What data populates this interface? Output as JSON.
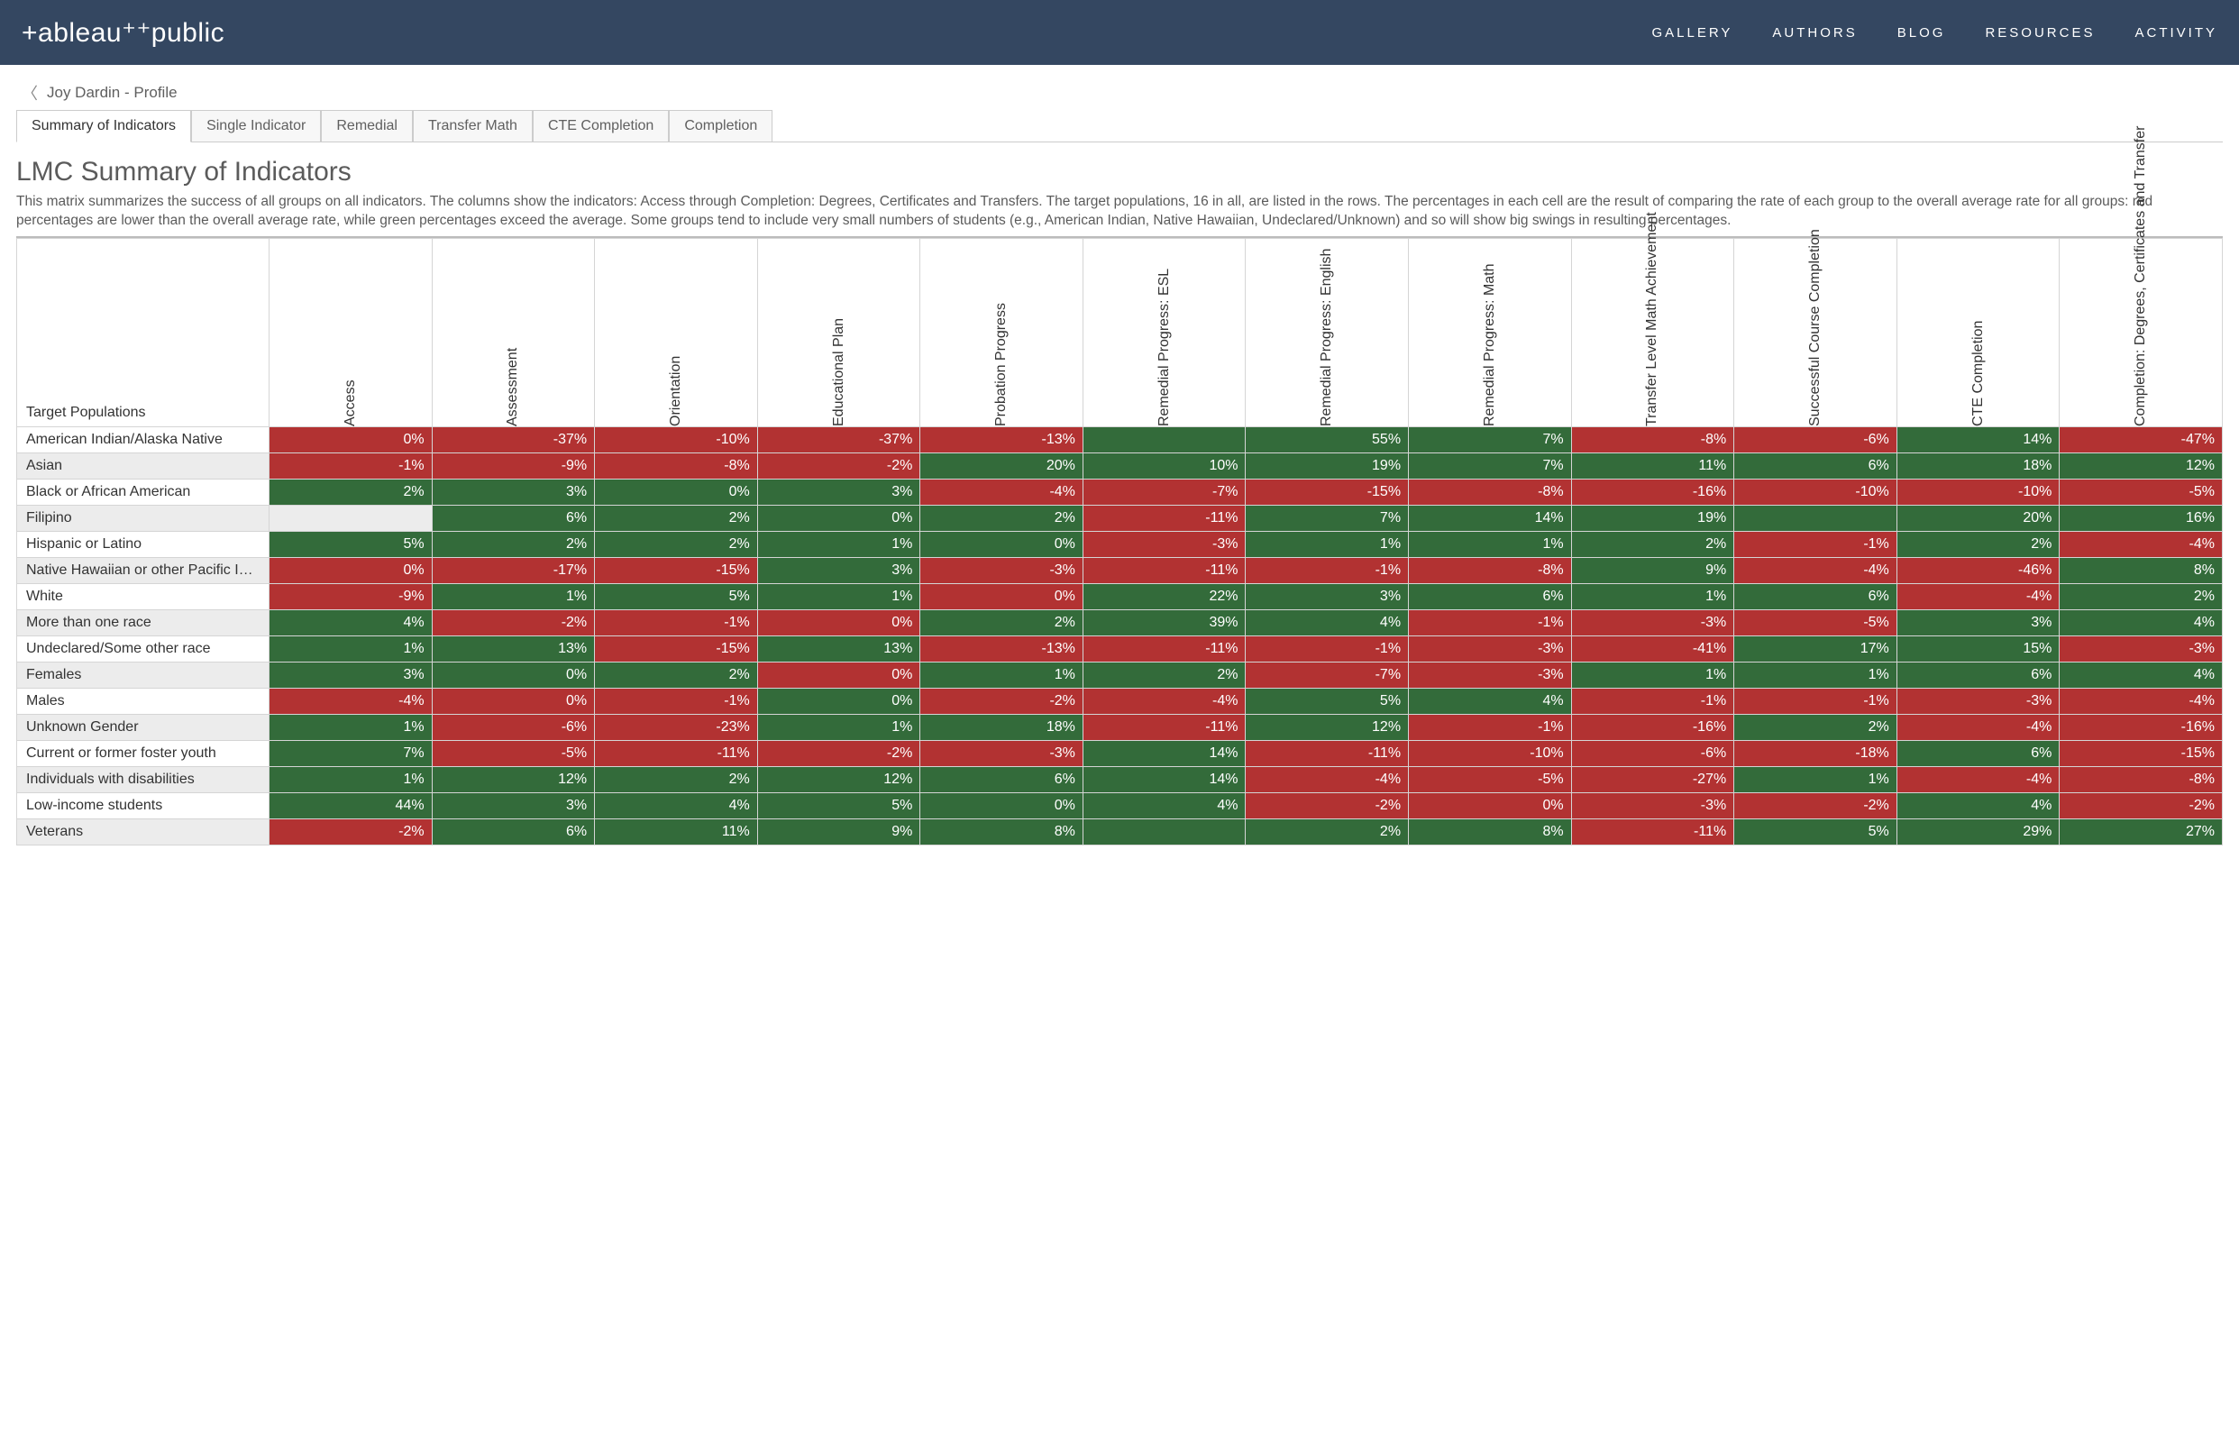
{
  "nav": {
    "brand": "+ableau⁺⁺public",
    "links": [
      "GALLERY",
      "AUTHORS",
      "BLOG",
      "RESOURCES",
      "ACTIVITY"
    ]
  },
  "breadcrumb": {
    "back_label": "Joy Dardin - Profile"
  },
  "tabs": [
    {
      "label": "Summary of Indicators",
      "active": true
    },
    {
      "label": "Single Indicator",
      "active": false
    },
    {
      "label": "Remedial",
      "active": false
    },
    {
      "label": "Transfer Math",
      "active": false
    },
    {
      "label": "CTE Completion",
      "active": false
    },
    {
      "label": "Completion",
      "active": false
    }
  ],
  "page": {
    "title": "LMC Summary of Indicators",
    "subtitle": "This matrix summarizes the success of all groups on all indicators. The columns show the indicators: Access through Completion: Degrees, Certificates and Transfers. The target populations, 16 in all, are listed in the rows. The percentages in each cell are the result of comparing the rate of each group to the overall average rate for all groups: red percentages are lower than the overall average rate, while green percentages exceed the average.  Some groups tend to include very small numbers of students (e.g., American Indian, Native Hawaiian, Undeclared/Unknown) and so will show big swings in resulting percentages.",
    "row_title": "Target Populations"
  },
  "colors": {
    "positive": "#336b3a",
    "negative": "#b23232",
    "nav_bg": "#344761"
  },
  "chart_data": {
    "type": "heatmap",
    "title": "LMC Summary of Indicators",
    "xlabel": "",
    "ylabel": "Target Populations",
    "columns": [
      "Access",
      "Assessment",
      "Orientation",
      "Educational Plan",
      "Probation Progress",
      "Remedial Progress: ESL",
      "Remedial Progress: English",
      "Remedial Progress: Math",
      "Transfer Level Math Achievement",
      "Successful Course Completion",
      "CTE Completion",
      "Completion: Degrees, Certificates and Transfer"
    ],
    "rows": [
      "American Indian/Alaska Native",
      "Asian",
      "Black or African American",
      "Filipino",
      "Hispanic or Latino",
      "Native Hawaiian or other Pacific Isla..",
      "White",
      "More than one race",
      "Undeclared/Some other race",
      "Females",
      "Males",
      "Unknown Gender",
      "Current or former foster youth",
      "Individuals with disabilities",
      "Low-income students",
      "Veterans"
    ],
    "values": [
      [
        0,
        -37,
        -10,
        -37,
        -13,
        null,
        55,
        7,
        -8,
        -6,
        14,
        -47
      ],
      [
        -1,
        -9,
        -8,
        -2,
        20,
        10,
        19,
        7,
        11,
        6,
        18,
        12
      ],
      [
        2,
        3,
        0,
        3,
        -4,
        -7,
        -15,
        -8,
        -16,
        -10,
        -10,
        -5
      ],
      [
        null,
        6,
        2,
        0,
        2,
        -11,
        7,
        14,
        19,
        null,
        20,
        16
      ],
      [
        5,
        2,
        2,
        1,
        0,
        -3,
        1,
        1,
        2,
        -1,
        2,
        -4
      ],
      [
        0,
        -17,
        -15,
        3,
        -3,
        -11,
        -1,
        -8,
        9,
        -4,
        -46,
        8
      ],
      [
        -9,
        1,
        5,
        1,
        0,
        22,
        3,
        6,
        1,
        6,
        -4,
        2
      ],
      [
        4,
        -2,
        -1,
        0,
        2,
        39,
        4,
        -1,
        -3,
        -5,
        3,
        4
      ],
      [
        1,
        13,
        -15,
        13,
        -13,
        -11,
        -1,
        -3,
        -41,
        17,
        15,
        -3
      ],
      [
        3,
        0,
        2,
        0,
        1,
        2,
        -7,
        -3,
        1,
        1,
        6,
        4
      ],
      [
        -4,
        0,
        -1,
        0,
        -2,
        -4,
        5,
        4,
        -1,
        -1,
        -3,
        -4
      ],
      [
        1,
        -6,
        -23,
        1,
        18,
        -11,
        12,
        -1,
        -16,
        2,
        -4,
        -16
      ],
      [
        7,
        -5,
        -11,
        -2,
        -3,
        14,
        -11,
        -10,
        -6,
        -18,
        6,
        -15
      ],
      [
        1,
        12,
        2,
        12,
        6,
        14,
        -4,
        -5,
        -27,
        1,
        -4,
        -8
      ],
      [
        44,
        3,
        4,
        5,
        0,
        4,
        -2,
        0,
        -3,
        -2,
        4,
        -2
      ],
      [
        -2,
        6,
        11,
        9,
        8,
        null,
        2,
        8,
        -11,
        5,
        29,
        27
      ]
    ],
    "signs": [
      [
        "neg",
        "neg",
        "neg",
        "neg",
        "neg",
        "pos",
        "pos",
        "pos",
        "neg",
        "neg",
        "pos",
        "neg"
      ],
      [
        "neg",
        "neg",
        "neg",
        "neg",
        "pos",
        "pos",
        "pos",
        "pos",
        "pos",
        "pos",
        "pos",
        "pos"
      ],
      [
        "pos",
        "pos",
        "pos",
        "pos",
        "neg",
        "neg",
        "neg",
        "neg",
        "neg",
        "neg",
        "neg",
        "neg"
      ],
      [
        "empty",
        "pos",
        "pos",
        "pos",
        "pos",
        "neg",
        "pos",
        "pos",
        "pos",
        "pos",
        "pos",
        "pos"
      ],
      [
        "pos",
        "pos",
        "pos",
        "pos",
        "pos",
        "neg",
        "pos",
        "pos",
        "pos",
        "neg",
        "pos",
        "neg"
      ],
      [
        "neg",
        "neg",
        "neg",
        "pos",
        "neg",
        "neg",
        "neg",
        "neg",
        "pos",
        "neg",
        "neg",
        "pos"
      ],
      [
        "neg",
        "pos",
        "pos",
        "pos",
        "neg",
        "pos",
        "pos",
        "pos",
        "pos",
        "pos",
        "neg",
        "pos"
      ],
      [
        "pos",
        "neg",
        "neg",
        "neg",
        "pos",
        "pos",
        "pos",
        "neg",
        "neg",
        "neg",
        "pos",
        "pos"
      ],
      [
        "pos",
        "pos",
        "neg",
        "pos",
        "neg",
        "neg",
        "neg",
        "neg",
        "neg",
        "pos",
        "pos",
        "neg"
      ],
      [
        "pos",
        "pos",
        "pos",
        "neg",
        "pos",
        "pos",
        "neg",
        "neg",
        "pos",
        "pos",
        "pos",
        "pos"
      ],
      [
        "neg",
        "neg",
        "neg",
        "pos",
        "neg",
        "neg",
        "pos",
        "pos",
        "neg",
        "neg",
        "neg",
        "neg"
      ],
      [
        "pos",
        "neg",
        "neg",
        "pos",
        "pos",
        "neg",
        "pos",
        "neg",
        "neg",
        "pos",
        "neg",
        "neg"
      ],
      [
        "pos",
        "neg",
        "neg",
        "neg",
        "neg",
        "pos",
        "neg",
        "neg",
        "neg",
        "neg",
        "pos",
        "neg"
      ],
      [
        "pos",
        "pos",
        "pos",
        "pos",
        "pos",
        "pos",
        "neg",
        "neg",
        "neg",
        "pos",
        "neg",
        "neg"
      ],
      [
        "pos",
        "pos",
        "pos",
        "pos",
        "pos",
        "pos",
        "neg",
        "neg",
        "neg",
        "neg",
        "pos",
        "neg"
      ],
      [
        "neg",
        "pos",
        "pos",
        "pos",
        "pos",
        "pos",
        "pos",
        "pos",
        "neg",
        "pos",
        "pos",
        "pos"
      ]
    ],
    "unit": "%"
  }
}
